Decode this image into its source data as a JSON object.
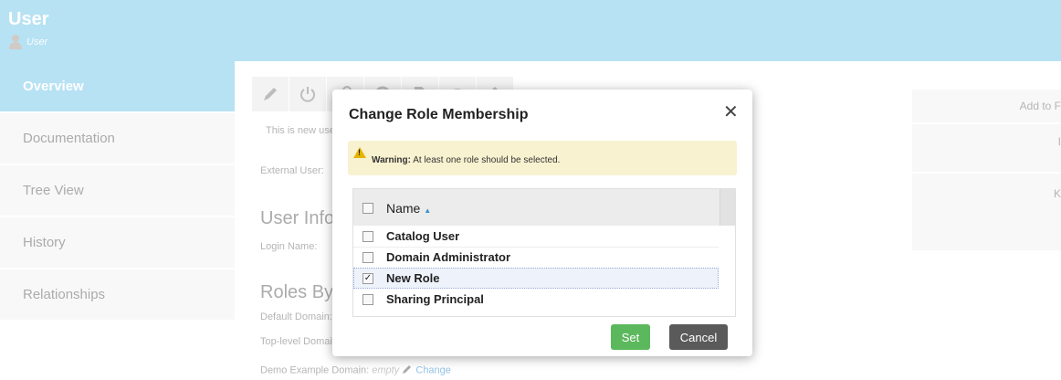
{
  "header": {
    "title": "User",
    "subtitle": "User"
  },
  "sidebar": {
    "items": [
      {
        "label": "Overview",
        "active": true
      },
      {
        "label": "Documentation"
      },
      {
        "label": "Tree View"
      },
      {
        "label": "History"
      },
      {
        "label": "Relationships"
      }
    ]
  },
  "toolbar": {
    "icons": [
      "pencil-icon",
      "power-icon",
      "key-icon",
      "circle-icon",
      "document-icon",
      "wifi-icon",
      "tag-icon"
    ]
  },
  "main": {
    "description": "This is new use",
    "external_user_label": "External User:",
    "user_info_title": "User Info",
    "login_name_label": "Login Name:",
    "roles_title": "Roles By",
    "default_domain_label": "Default Domain:",
    "top_level_domain_label": "Top-level Domai",
    "demo_domain_label": "Demo Example Domain:",
    "demo_domain_value": "empty",
    "change_link": "Change"
  },
  "right_panel": {
    "add_to": "Add to F",
    "item2": "I",
    "item3": "K"
  },
  "modal": {
    "title": "Change Role Membership",
    "close": "✕",
    "warning_bold": "Warning:",
    "warning_text": "At least one role should be selected.",
    "column_name": "Name",
    "roles": [
      {
        "label": "Catalog User",
        "checked": false
      },
      {
        "label": "Domain Administrator",
        "checked": false
      },
      {
        "label": "New Role",
        "checked": true
      },
      {
        "label": "Sharing Principal",
        "checked": false
      }
    ],
    "set_label": "Set",
    "cancel_label": "Cancel"
  }
}
